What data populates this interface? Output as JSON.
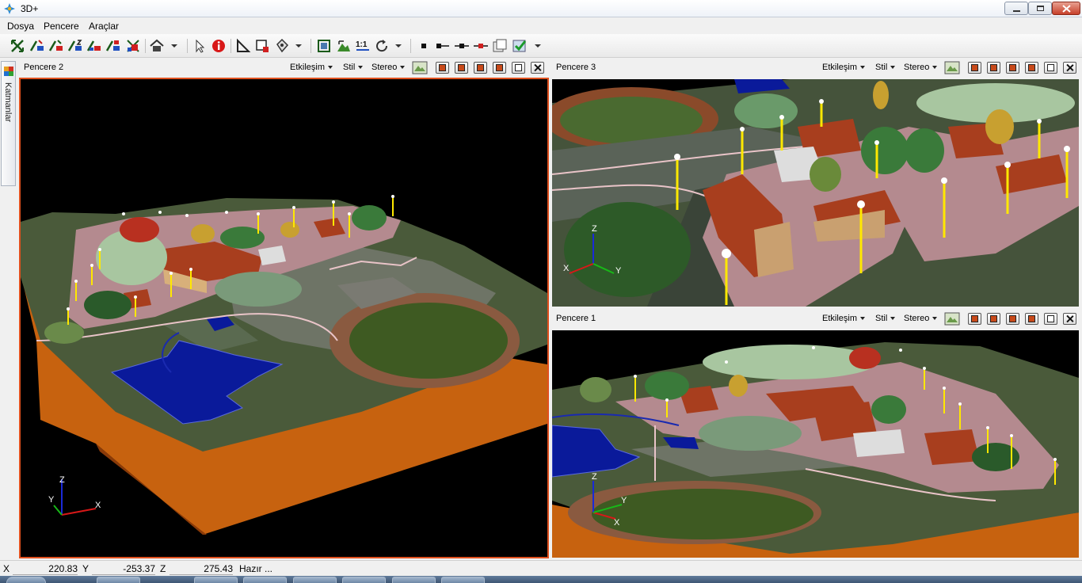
{
  "window": {
    "title": "3D+"
  },
  "menu": {
    "items": [
      "Dosya",
      "Pencere",
      "Araçlar"
    ]
  },
  "toolbar": {
    "icons": [
      "zoom-extents-icon",
      "zoom-x-icon",
      "zoom-y-icon",
      "zoom-z-icon",
      "zoom-xy-icon",
      "zoom-layer-icon",
      "home-icon",
      "pointer-icon",
      "info-icon",
      "measure-icon",
      "select-area-icon",
      "style-icon",
      "fit-icon",
      "terrain-icon",
      "scale-1-1-icon",
      "rotate-icon",
      "point-icon",
      "line-icon",
      "link-icon",
      "unlink-icon",
      "window-icon",
      "check-icon"
    ]
  },
  "dock": {
    "label": "Katmanlar"
  },
  "panels": {
    "p2": {
      "title": "Pencere 2",
      "interaction": "Etkileşim",
      "style": "Stil",
      "stereo": "Stereo"
    },
    "p3": {
      "title": "Pencere 3",
      "interaction": "Etkileşim",
      "style": "Stil",
      "stereo": "Stereo"
    },
    "p1": {
      "title": "Pencere 1",
      "interaction": "Etkileşim",
      "style": "Stil",
      "stereo": "Stereo"
    }
  },
  "axes": {
    "x": "X",
    "y": "Y",
    "z": "Z"
  },
  "status": {
    "x_label": "X",
    "x_value": "220.83",
    "y_label": "Y",
    "y_value": "-253.37",
    "z_label": "Z",
    "z_value": "275.43",
    "message": "Hazır ..."
  },
  "colors": {
    "active_border": "#e0501e",
    "terrain_side": "#c7620f",
    "water": "#0a1a9a",
    "road": "#b48a8f",
    "light_pole": "#ffe800"
  }
}
